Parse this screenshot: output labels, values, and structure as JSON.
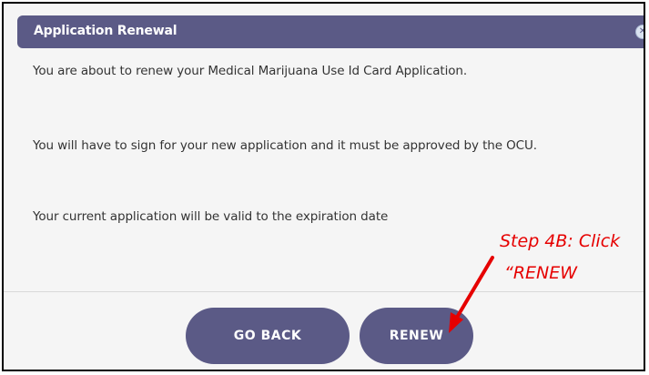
{
  "dialog": {
    "title": "Application Renewal",
    "close_icon": "close-circle-icon",
    "lines": [
      "You are about to renew your Medical Marijuana Use Id Card Application.",
      "You will have to sign for your new application and it must be approved by the OCU.",
      "Your current application will be valid to the expiration date"
    ],
    "buttons": {
      "back_label": "GO BACK",
      "renew_label": "RENEW"
    }
  },
  "annotation": {
    "line1": "Step 4B: Click",
    "line2": "“RENEW",
    "color": "#e60000"
  },
  "colors": {
    "accent": "#5b5a86",
    "background": "#f5f5f5"
  }
}
